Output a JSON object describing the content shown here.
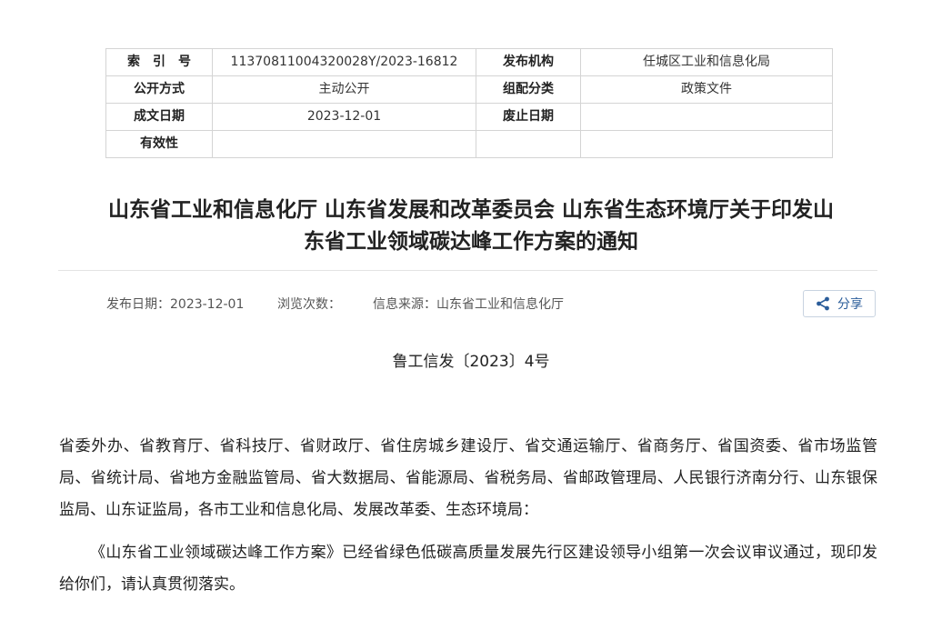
{
  "meta_table": {
    "rows": [
      [
        {
          "key": "索　引　号",
          "value": "11370811004320028Y/2023-16812"
        },
        {
          "key": "发布机构",
          "value": "任城区工业和信息化局"
        }
      ],
      [
        {
          "key": "公开方式",
          "value": "主动公开"
        },
        {
          "key": "组配分类",
          "value": "政策文件"
        }
      ],
      [
        {
          "key": "成文日期",
          "value": "2023-12-01"
        },
        {
          "key": "废止日期",
          "value": ""
        }
      ],
      [
        {
          "key": "有效性",
          "value": ""
        },
        {
          "key": "",
          "value": ""
        }
      ]
    ]
  },
  "article": {
    "title_line1": "山东省工业和信息化厅 山东省发展和改革委员会 山东省生态环境厅关于印发山",
    "title_line2": "东省工业领域碳达峰工作方案的通知",
    "publish_date": "发布日期：2023-12-01",
    "views": "浏览次数：",
    "source": "信息来源：山东省工业和信息化厅",
    "share_label": "分享",
    "doc_number": "鲁工信发〔2023〕4号",
    "recipients": "省委外办、省教育厅、省科技厅、省财政厅、省住房城乡建设厅、省交通运输厅、省商务厅、省国资委、省市场监管局、省统计局、省地方金融监管局、省大数据局、省能源局、省税务局、省邮政管理局、人民银行济南分行、山东银保监局、山东证监局，各市工业和信息化局、发展改革委、生态环境局：",
    "paragraph1": "《山东省工业领域碳达峰工作方案》已经省绿色低碳高质量发展先行区建设领导小组第一次会议审议通过，现印发给你们，请认真贯彻落实。"
  },
  "icons": {
    "share": "share-icon"
  },
  "colors": {
    "share_accent": "#2b5d9a",
    "border": "#d4d4d4"
  }
}
